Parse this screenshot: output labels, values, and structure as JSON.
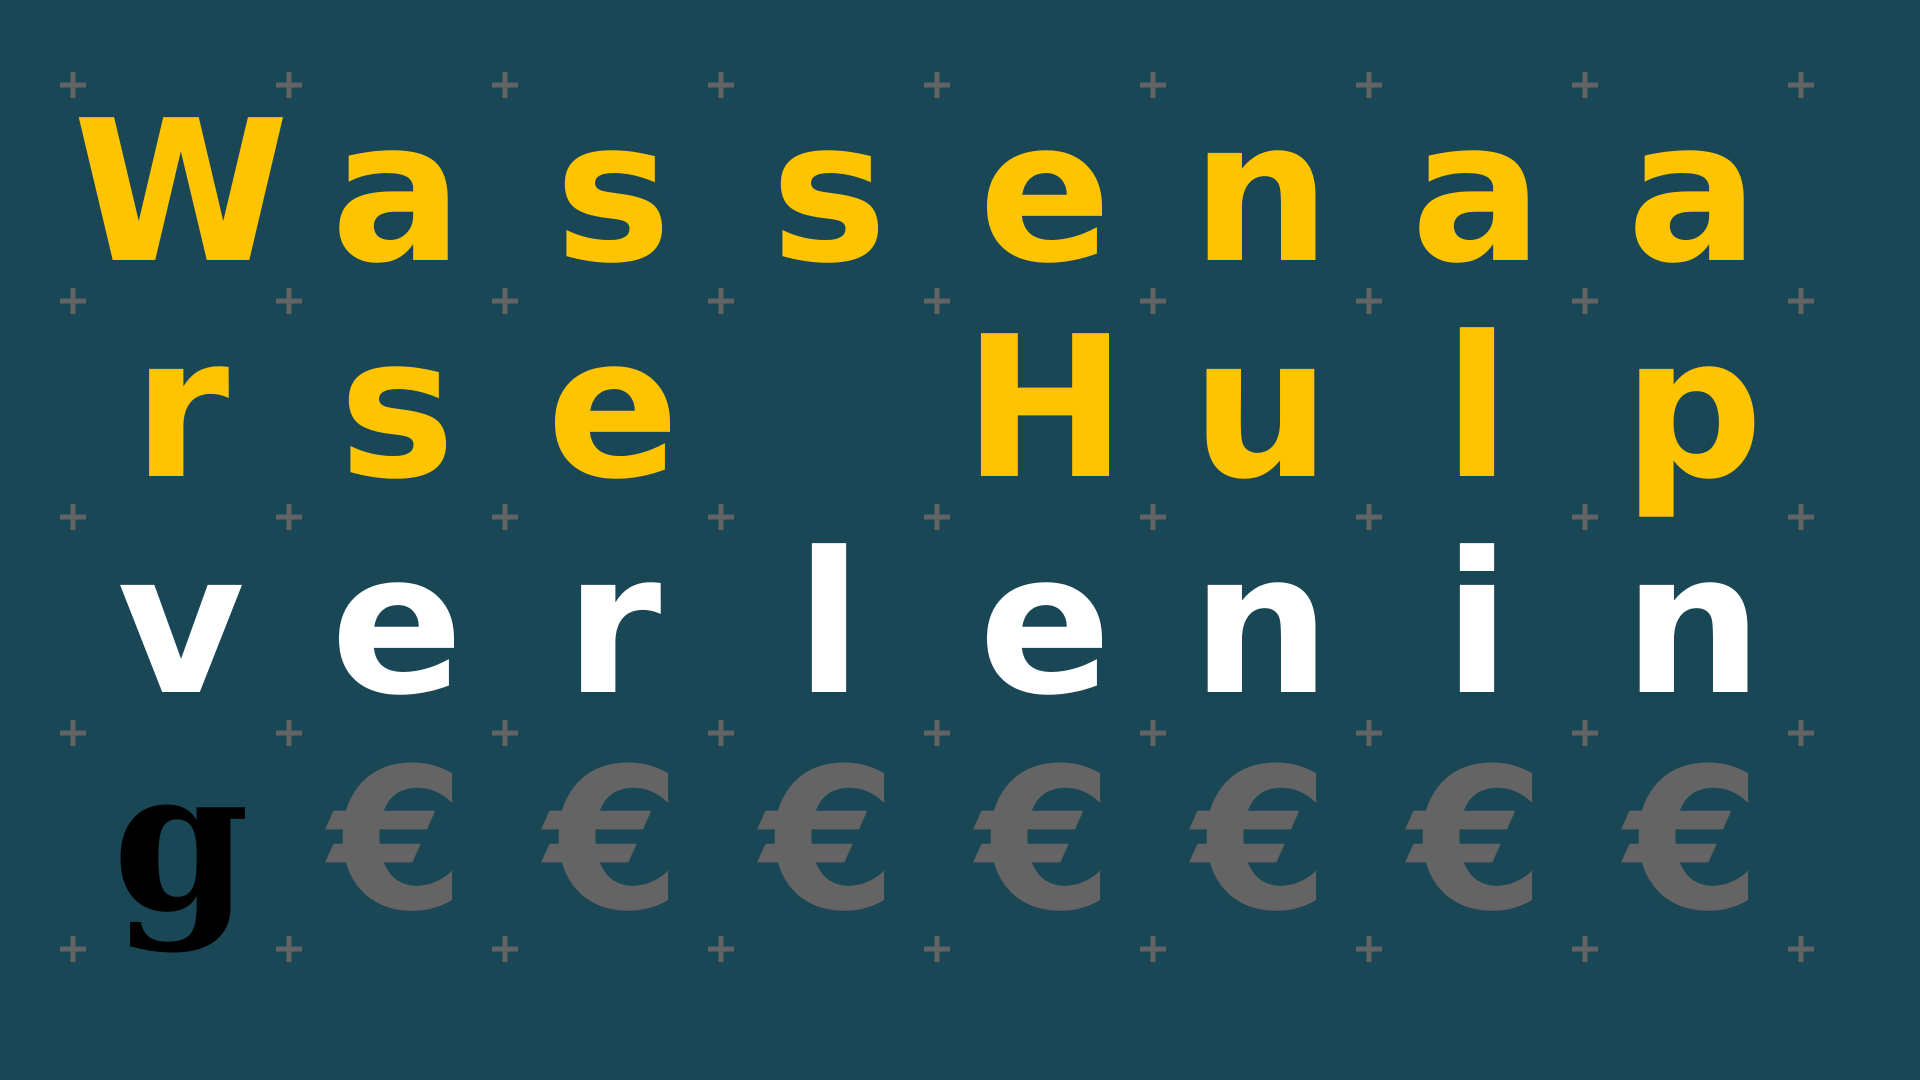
{
  "grid": {
    "rows": [
      {
        "color": "#ffc400",
        "letters": [
          "W",
          "a",
          "s",
          "s",
          "e",
          "n",
          "a",
          "a"
        ]
      },
      {
        "color": "#ffc400",
        "letters": [
          "r",
          "s",
          "e",
          "",
          "H",
          "u",
          "l",
          "p"
        ]
      },
      {
        "color": "#ffffff",
        "letters": [
          "v",
          "e",
          "r",
          "l",
          "e",
          "n",
          "i",
          "n"
        ]
      },
      {
        "color": "#646464",
        "letters": [
          "g",
          "€",
          "€",
          "€",
          "€",
          "€",
          "€",
          "€"
        ],
        "first_color": "#000000"
      }
    ]
  },
  "colors": {
    "background": "#1a4756",
    "plus": "#636363"
  }
}
